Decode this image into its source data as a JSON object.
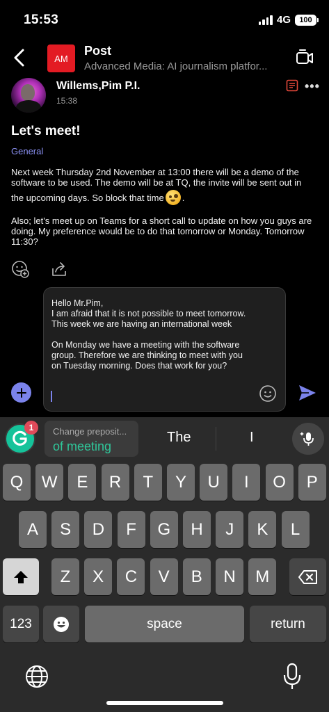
{
  "status_bar": {
    "time": "15:53",
    "network": "4G",
    "battery": "100"
  },
  "header": {
    "back_icon": "chevron-left-icon",
    "avatar_initials": "AM",
    "avatar_color": "#e31b23",
    "title": "Post",
    "subtitle": "Advanced Media: AI journalism platfor...",
    "video_icon": "video-call-icon"
  },
  "post": {
    "author": "Willems,Pim P.I.",
    "time": "15:38",
    "title": "Let's meet!",
    "tag": "General",
    "tag_color": "#8c92f5",
    "body_1a": "Next week Thursday 2nd November at 13:00 there will be a demo of the software to be used. The demo will be at TQ, the invite will be sent out in",
    "body_1b": "the upcoming days. So block that time",
    "body_1c": ".",
    "body_2": "Also; let's meet up on Teams for a short call to update on how you guys are doing. My preference would be to do that tomorrow or Monday. Tomorrow 11:30?"
  },
  "compose": {
    "text": "Hello Mr.Pim,\nI am afraid that it is not possible to meet tomorrow. This week we are having an international week\n\nOn Monday we have a meeting with the software group. Therefore we are thinking to meet with you on Tuesday morning. Does that work for you?",
    "accent": "#7b83eb"
  },
  "keyboard": {
    "grammarly_badge": "1",
    "grammarly_hint": "Change preposit...",
    "grammarly_suggestion": "of meeting",
    "suggestion_1": "The",
    "suggestion_2": "I",
    "row1": [
      "Q",
      "W",
      "E",
      "R",
      "T",
      "Y",
      "U",
      "I",
      "O",
      "P"
    ],
    "row2": [
      "A",
      "S",
      "D",
      "F",
      "G",
      "H",
      "J",
      "K",
      "L"
    ],
    "row3": [
      "Z",
      "X",
      "C",
      "V",
      "B",
      "N",
      "M"
    ],
    "numbers_label": "123",
    "space_label": "space",
    "return_label": "return"
  }
}
